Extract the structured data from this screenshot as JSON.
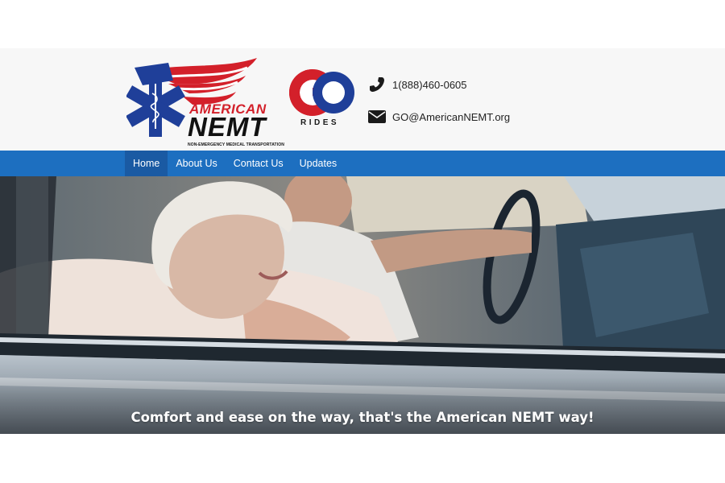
{
  "header": {
    "logo_american": "AMERICAN",
    "logo_nemt": "NEMT",
    "logo_subtitle": "NON-EMERGENCY MEDICAL TRANSPORTATION",
    "go_logo_text": "RIDES",
    "phone": "1(888)460-0605",
    "email": "GO@AmericanNEMT.org",
    "phone_icon": "phone-icon",
    "email_icon": "envelope-icon"
  },
  "nav": {
    "items": [
      {
        "label": "Home",
        "active": true
      },
      {
        "label": "About Us",
        "active": false
      },
      {
        "label": "Contact Us",
        "active": false
      },
      {
        "label": "Updates",
        "active": false
      }
    ]
  },
  "hero": {
    "caption": "Comfort and ease on the way, that's the American NEMT way!"
  },
  "colors": {
    "nav_bg": "#1d6fc0",
    "nav_active_bg": "#1a5aa3",
    "brand_red": "#d3202a",
    "brand_blue": "#1f3f99"
  }
}
